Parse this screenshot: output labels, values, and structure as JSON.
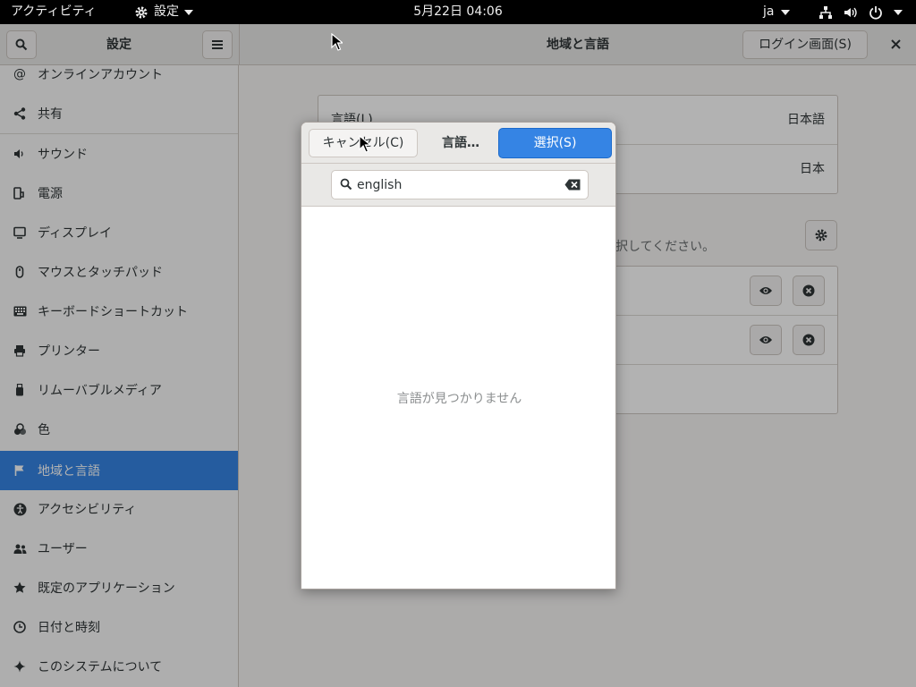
{
  "topbar": {
    "activities": "アクティビティ",
    "app_menu": "設定",
    "clock": "5月22日 04:06",
    "input_method": "ja"
  },
  "headerbar": {
    "sidebar_title": "設定",
    "panel_title": "地域と言語",
    "login_button": "ログイン画面(S)"
  },
  "sidebar": {
    "items": [
      {
        "label": "オンラインアカウント",
        "icon": "at-icon"
      },
      {
        "label": "共有",
        "icon": "share-icon"
      },
      {
        "label": "サウンド",
        "icon": "speaker-icon"
      },
      {
        "label": "電源",
        "icon": "power-plug-icon"
      },
      {
        "label": "ディスプレイ",
        "icon": "display-icon"
      },
      {
        "label": "マウスとタッチパッド",
        "icon": "mouse-icon"
      },
      {
        "label": "キーボードショートカット",
        "icon": "keyboard-icon"
      },
      {
        "label": "プリンター",
        "icon": "printer-icon"
      },
      {
        "label": "リムーバブルメディア",
        "icon": "usb-drive-icon"
      },
      {
        "label": "色",
        "icon": "color-icon"
      },
      {
        "label": "地域と言語",
        "icon": "flag-icon",
        "active": true
      },
      {
        "label": "アクセシビリティ",
        "icon": "accessibility-icon"
      },
      {
        "label": "ユーザー",
        "icon": "users-icon"
      },
      {
        "label": "既定のアプリケーション",
        "icon": "star-icon"
      },
      {
        "label": "日付と時刻",
        "icon": "clock-icon"
      },
      {
        "label": "このシステムについて",
        "icon": "sparkle-icon"
      }
    ]
  },
  "main": {
    "language_label": "言語(L)",
    "language_value": "日本語",
    "formats_value": "日本",
    "input_hint": "択してください。"
  },
  "dialog": {
    "cancel_button": "キャンセル(C)",
    "title": "言語…",
    "select_button": "選択(S)",
    "search_value": "english",
    "empty_message": "言語が見つかりません"
  },
  "colors": {
    "accent": "#3584e4",
    "topbar": "#000000"
  }
}
